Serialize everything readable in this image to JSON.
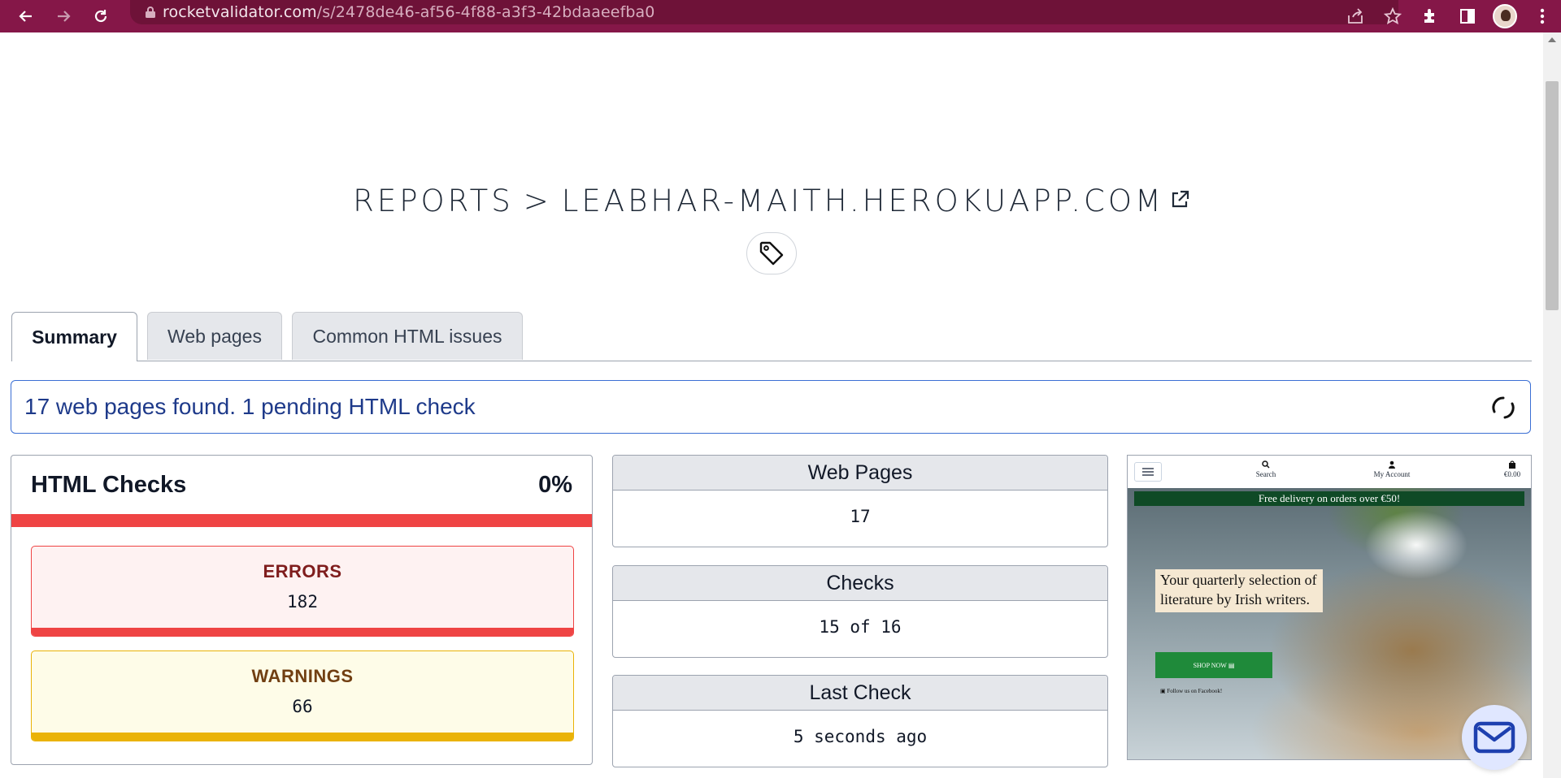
{
  "browser": {
    "url_host": "rocketvalidator.com",
    "url_path": "/s/2478de46-af56-4f88-a3f3-42bdaaeefba0"
  },
  "header": {
    "breadcrumb_root": "REPORTS",
    "breadcrumb_separator": ">",
    "site": "LEABHAR-MAITH.HEROKUAPP.COM"
  },
  "tabs": [
    {
      "label": "Summary",
      "active": true
    },
    {
      "label": "Web pages",
      "active": false
    },
    {
      "label": "Common HTML issues",
      "active": false
    }
  ],
  "banner": {
    "text": "17 web pages found. 1 pending HTML check"
  },
  "html_checks": {
    "title": "HTML Checks",
    "percent": "0%",
    "errors_label": "ERRORS",
    "errors_value": "182",
    "warnings_label": "WARNINGS",
    "warnings_value": "66"
  },
  "stats": {
    "web_pages_label": "Web Pages",
    "web_pages_value": "17",
    "checks_label": "Checks",
    "checks_value": "15 of 16",
    "last_check_label": "Last Check",
    "last_check_value": "5 seconds ago"
  },
  "preview": {
    "nav_search": "Search",
    "nav_account": "My Account",
    "nav_cart": "€0.00",
    "delivery": "Free delivery on orders over €50!",
    "quote": "Your quarterly selection of literature by Irish writers.",
    "shop_button": "SHOP NOW",
    "facebook": "Follow us on Facebook!"
  },
  "colors": {
    "browser_chrome": "#851748",
    "error": "#ef4444",
    "warning": "#eab308",
    "banner_text": "#1e3a8a"
  },
  "icons": [
    "back-icon",
    "forward-icon",
    "reload-icon",
    "lock-icon",
    "share-icon",
    "star-icon",
    "extensions-icon",
    "sidepanel-icon",
    "profile-avatar",
    "menu-dots-icon",
    "external-link-icon",
    "tag-icon",
    "spinner-icon",
    "mail-icon"
  ]
}
